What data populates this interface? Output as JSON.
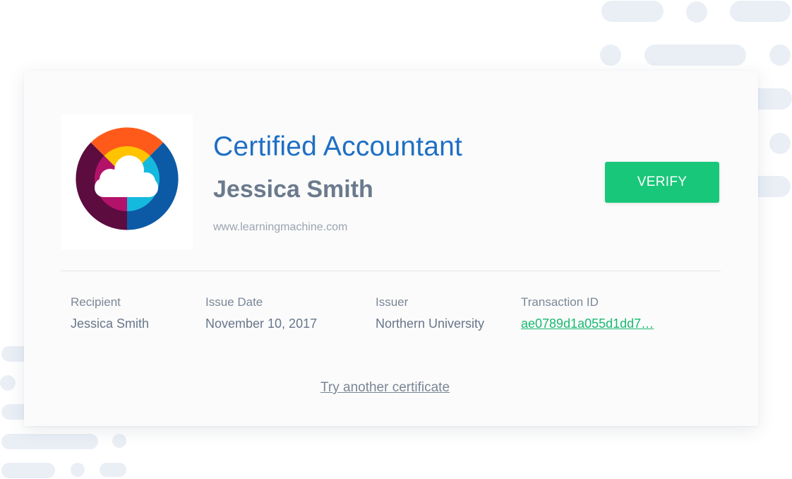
{
  "certificate": {
    "title": "Certified Accountant",
    "recipient_name": "Jessica Smith",
    "issuer_url": "www.learningmachine.com",
    "verify_label": "VERIFY",
    "logo_icon": "cloud-ring-logo-icon"
  },
  "details": {
    "recipient": {
      "label": "Recipient",
      "value": "Jessica Smith"
    },
    "issue_date": {
      "label": "Issue Date",
      "value": "November 10, 2017"
    },
    "issuer": {
      "label": "Issuer",
      "value": "Northern University"
    },
    "transaction": {
      "label": "Transaction ID",
      "value": "ae0789d1a055d1dd7…"
    }
  },
  "footer": {
    "try_another_label": "Try another certificate"
  },
  "colors": {
    "title_blue": "#1f6fc4",
    "verify_green": "#19c77a",
    "link_green": "#17b96f",
    "text_gray": "#6b7a8d",
    "decoration": "#eaeff6"
  }
}
